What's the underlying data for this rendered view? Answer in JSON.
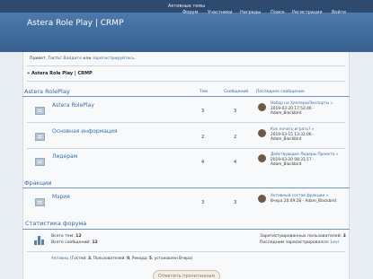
{
  "topbar": {
    "text": "Активные темы"
  },
  "header": {
    "title": "Astera Role Play | CRMP",
    "nav": [
      "Форум",
      "Участники",
      "Награды",
      "Поиск",
      "Регистрация",
      "Войти"
    ]
  },
  "greeting": {
    "prefix": "Привет, Гость!",
    "login": "Войдите",
    "or": "или",
    "register": "зарегистрируйтесь."
  },
  "breadcrumb": "» Astera Role Play | CRMP",
  "columns": {
    "topics": "Тем",
    "posts": "Сообщений",
    "last_post": "Последнее сообщение"
  },
  "categories": [
    {
      "name": "Astera RolePlay",
      "forums": [
        {
          "name": "Astera RolePlay",
          "topics": "3",
          "posts": "3",
          "last_title": "Набор на Хелперы/Экспорты »",
          "last_date": "2019-03-20 17:52:46 -",
          "last_author": "Adam_Blackbird"
        },
        {
          "name": "Основная информация",
          "topics": "2",
          "posts": "2",
          "last_title": "Как начать играть? »",
          "last_date": "2019-03-15 13:32:06 -",
          "last_author": "Adam_Blackbird"
        },
        {
          "name": "Лидерам",
          "topics": "4",
          "posts": "4",
          "last_title": "Действующие Лидеры Проекта »",
          "last_date": "2019-03-20 08:31:17 -",
          "last_author": "Adam_Blackbird"
        }
      ]
    },
    {
      "name": "Фракции",
      "forums": [
        {
          "name": "Мэрия",
          "topics": "3",
          "posts": "3",
          "last_title": "Активный состав фракции »",
          "last_date": "Вчера 20:49:28 -",
          "last_author": "Adam_Blackbird"
        }
      ]
    }
  ],
  "stats": {
    "title": "Статистика форума",
    "total_topics_label": "Всего тем:",
    "total_topics": "12",
    "total_posts_label": "Всего сообщений:",
    "total_posts": "12",
    "registered_label": "Зарегистрированных пользователей:",
    "registered": "3",
    "newest_label": "Последним зарегистрировался:",
    "newest": "Levi"
  },
  "online": {
    "label": "Активны",
    "text_a": "(Гостей:",
    "guests": "3",
    "text_b": ", Пользователей:",
    "users": "0",
    "text_c": ", Рекорд:",
    "record": "5",
    "text_d": ", установлен Вчера)"
  },
  "mark_read": "Отметить прочитанным"
}
